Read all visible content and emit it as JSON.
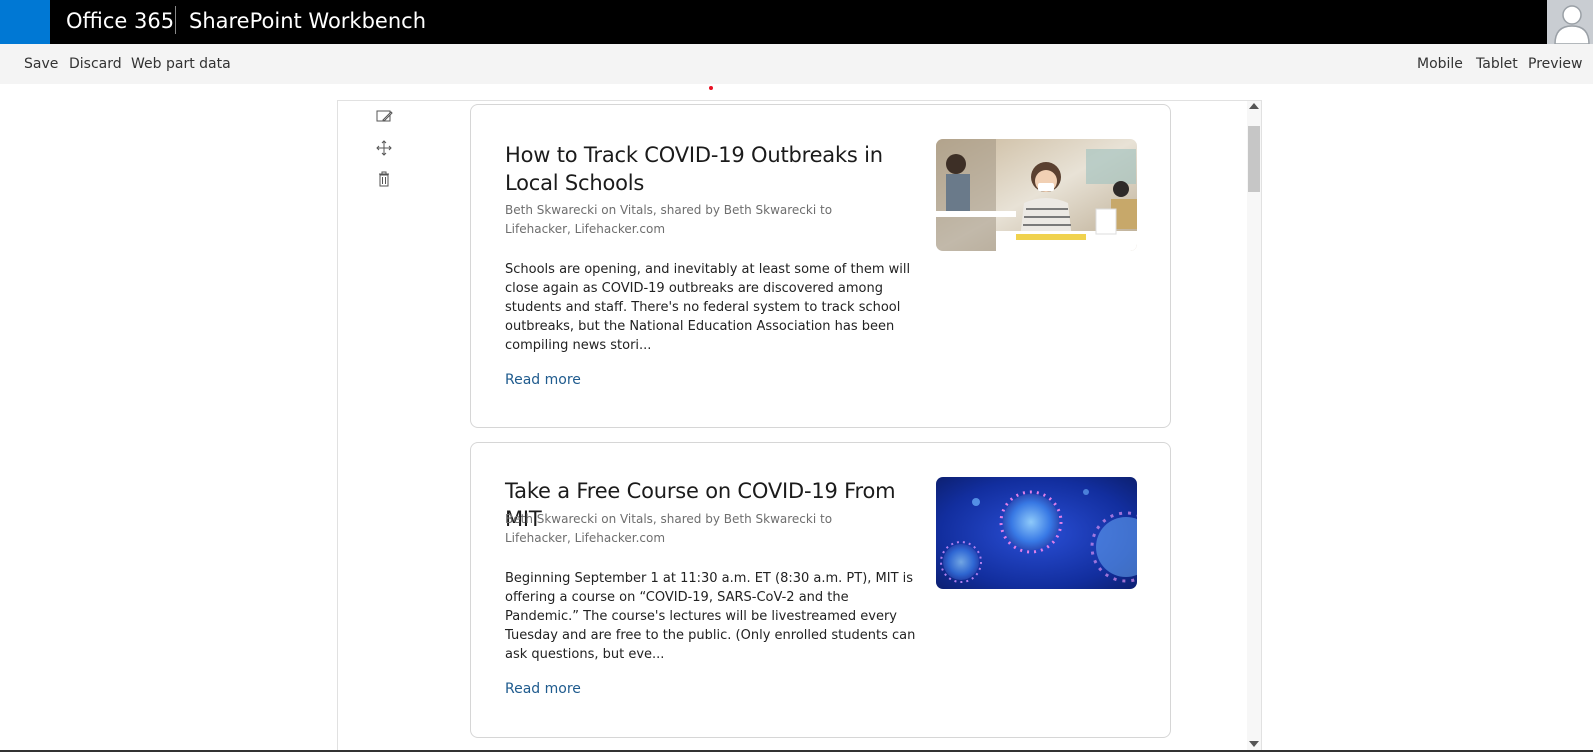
{
  "suitebar": {
    "brand": "Office 365",
    "app_name": "SharePoint Workbench"
  },
  "commandbar": {
    "save_label": "Save",
    "discard_label": "Discard",
    "webpart_data_label": "Web part data",
    "mobile_label": "Mobile",
    "tablet_label": "Tablet",
    "preview_label": "Preview"
  },
  "toolbox": {
    "icons": [
      "edit-icon",
      "move-icon",
      "delete-icon"
    ]
  },
  "articles": [
    {
      "title": "How to Track COVID-19 Outbreaks in Local Schools",
      "meta": "Beth Skwarecki on Vitals, shared by Beth Skwarecki to Lifehacker, Lifehacker.com",
      "body": "Schools are opening, and inevitably at least some of them will close again as COVID-19 outbreaks are discovered among students and staff. There's no federal system to track school outbreaks, but the National Education Association has been compiling news stori...",
      "link_label": "Read more",
      "image": "classroom-photo"
    },
    {
      "title": "Take a Free Course on COVID-19 From MIT",
      "meta": "Beth Skwarecki on Vitals, shared by Beth Skwarecki to Lifehacker, Lifehacker.com",
      "body": "Beginning September 1 at 11:30 a.m. ET (8:30 a.m. PT), MIT is offering a course on “COVID-19, SARS-CoV-2 and the Pandemic.” The course's lectures will be livestreamed every Tuesday and are free to the public. (Only enrolled students can ask questions, but eve...",
      "link_label": "Read more",
      "image": "virus-illustration"
    }
  ],
  "colors": {
    "suitebar": "#000000",
    "waffle": "#0078d4",
    "commandbar": "#f4f4f4",
    "link": "#1f5b8e"
  }
}
